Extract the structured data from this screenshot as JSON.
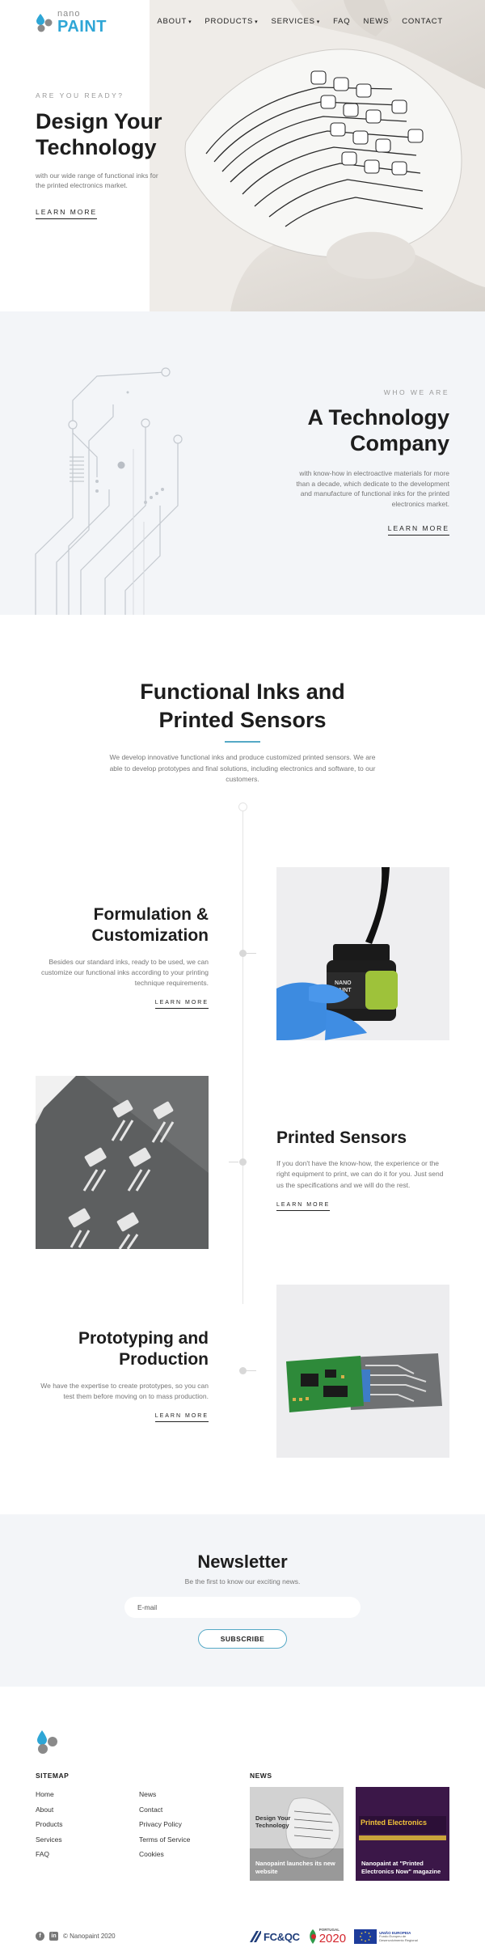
{
  "brand": {
    "nano": "nano",
    "paint": "PAINT"
  },
  "nav": [
    {
      "label": "ABOUT",
      "dropdown": true
    },
    {
      "label": "PRODUCTS",
      "dropdown": true
    },
    {
      "label": "SERVICES",
      "dropdown": true
    },
    {
      "label": "FAQ",
      "dropdown": false
    },
    {
      "label": "NEWS",
      "dropdown": false
    },
    {
      "label": "CONTACT",
      "dropdown": false
    }
  ],
  "hero": {
    "eyebrow": "ARE YOU READY?",
    "title_line1": "Design Your",
    "title_line2": "Technology",
    "desc": "with our wide range of functional inks for the printed electronics market.",
    "cta": "LEARN MORE"
  },
  "who": {
    "eyebrow": "WHO WE ARE",
    "title_line1": "A Technology",
    "title_line2": "Company",
    "desc": "with know-how in electroactive materials for more than a decade, which dedicate to the development and manufacture of functional inks for the printed electronics market.",
    "cta": "LEARN MORE"
  },
  "inks": {
    "title_line1": "Functional Inks and",
    "title_line2": "Printed Sensors",
    "desc": "We develop innovative functional inks and produce customized printed sensors. We are able to develop prototypes and final solutions, including electronics and software, to our customers."
  },
  "features": [
    {
      "title_line1": "Formulation &",
      "title_line2": "Customization",
      "desc": "Besides our standard inks, ready to be used, we can customize our functional inks according to your printing technique requirements.",
      "cta": "LEARN MORE",
      "bottle_label_line1": "NANO",
      "bottle_label_line2": "PAINT"
    },
    {
      "title_line1": "Printed Sensors",
      "title_line2": "",
      "desc": "If you don't have the know-how, the experience or the right equipment to print, we can do it for you. Just send us the specifications and we will do the rest.",
      "cta": "LEARN MORE"
    },
    {
      "title_line1": "Prototyping and",
      "title_line2": "Production",
      "desc": "We have the expertise to create prototypes, so you can test them before moving on to mass production.",
      "cta": "LEARN MORE"
    }
  ],
  "newsletter": {
    "title": "Newsletter",
    "subtitle": "Be the first to know our exciting news.",
    "placeholder": "E-mail",
    "button": "SUBSCRIBE"
  },
  "footer": {
    "sitemap_heading": "SITEMAP",
    "col1": [
      "Home",
      "About",
      "Products",
      "Services",
      "FAQ"
    ],
    "col2": [
      "News",
      "Contact",
      "Privacy Policy",
      "Terms of Service",
      "Cookies"
    ],
    "news_heading": "NEWS",
    "news_cards": [
      {
        "caption": "Nanopaint launches its new website",
        "thumb_title": "Design Your Technology"
      },
      {
        "caption": "Nanopaint at \"Printed Electronics Now\" magazine",
        "thumb_title": "Printed Electronics"
      }
    ],
    "copyright": "© Nanopaint 2020",
    "partners": {
      "fcqc": "FC&QC",
      "portugal_small": "PORTUGAL",
      "portugal": "2020",
      "eu_line1": "UNIÃO EUROPEIA",
      "eu_line2": "Fundo Europeu de Desenvolvimento Regional"
    }
  },
  "colors": {
    "accent": "#2ea6d6",
    "rule": "#55a9c6",
    "section_bg": "#f3f5f8",
    "text_dark": "#1d1d1d",
    "text_muted": "#777777"
  },
  "icons": [
    "droplets-logo-icon",
    "caret-down-icon",
    "facebook-icon",
    "linkedin-icon"
  ]
}
